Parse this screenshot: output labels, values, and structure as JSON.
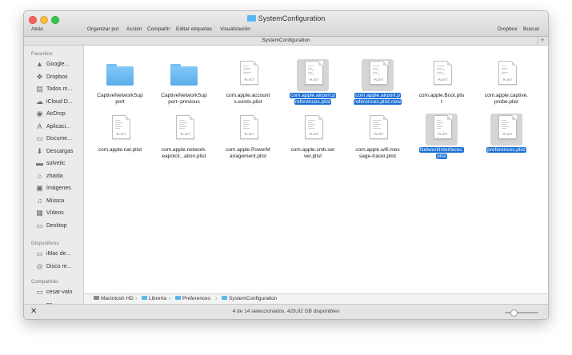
{
  "window": {
    "title": "SystemConfiguration"
  },
  "toolbar": {
    "back": "Atrás",
    "organize": "Organizar por",
    "action": "Acción",
    "share": "Compartir",
    "tags": "Editar etiquetas",
    "view": "Visualización",
    "dropbox": "Dropbox",
    "search": "Buscar"
  },
  "tabbar": {
    "title": "SystemConfiguration"
  },
  "sidebar": {
    "favorites_header": "Favoritos",
    "favorites": [
      {
        "label": "Google...",
        "icon": "google-drive-icon"
      },
      {
        "label": "Dropbox",
        "icon": "dropbox-icon"
      },
      {
        "label": "Todos m...",
        "icon": "all-files-icon"
      },
      {
        "label": "iCloud D...",
        "icon": "icloud-icon"
      },
      {
        "label": "AirDrop",
        "icon": "airdrop-icon"
      },
      {
        "label": "Aplicaci...",
        "icon": "applications-icon"
      },
      {
        "label": "Docume...",
        "icon": "documents-icon"
      },
      {
        "label": "Descargas",
        "icon": "downloads-icon"
      },
      {
        "label": "solvetic",
        "icon": "folder-icon"
      },
      {
        "label": "zhaida",
        "icon": "home-icon"
      },
      {
        "label": "Imágenes",
        "icon": "pictures-icon"
      },
      {
        "label": "Música",
        "icon": "music-icon"
      },
      {
        "label": "Vídeos",
        "icon": "movies-icon"
      },
      {
        "label": "Desktop",
        "icon": "desktop-icon"
      }
    ],
    "devices_header": "Dispositivos",
    "devices": [
      {
        "label": "iMac de...",
        "icon": "imac-icon"
      },
      {
        "label": "Disco re...",
        "icon": "disk-icon"
      }
    ],
    "shared_header": "Compartido",
    "shared": [
      {
        "label": "cesar-vaio",
        "icon": "network-computer-icon"
      },
      {
        "label": "pc...",
        "icon": "network-computer-icon"
      }
    ]
  },
  "files": [
    {
      "name": "CaptiveNetworkSupport",
      "line1": "CaptiveNetworkSup",
      "line2": "port",
      "kind": "folder",
      "selected": false
    },
    {
      "name": "CaptiveNetworkSupport~previous",
      "line1": "CaptiveNetworkSup",
      "line2": "port~previous",
      "kind": "folder",
      "selected": false
    },
    {
      "name": "com.apple.accounts.exists.plist",
      "line1": "com.apple.account",
      "line2": "s.exists.plist",
      "kind": "plist",
      "selected": false
    },
    {
      "name": "com.apple.airport.preferences.plist",
      "line1": "com.apple.airport.p",
      "line2": "references.plist",
      "kind": "plist",
      "selected": true
    },
    {
      "name": "com.apple.airport.preferences.plist-new",
      "line1": "com.apple.airport.p",
      "line2": "references.plist-new",
      "kind": "plist",
      "selected": true
    },
    {
      "name": "com.apple.Boot.plist",
      "line1": "com.apple.Boot.plis",
      "line2": "t",
      "kind": "plist",
      "selected": false
    },
    {
      "name": "com.apple.captive.probe.plist",
      "line1": "com.apple.captive.",
      "line2": "probe.plist",
      "kind": "plist",
      "selected": false
    },
    {
      "name": "com.apple.nat.plist",
      "line1": "com.apple.nat.plist",
      "line2": "",
      "kind": "plist",
      "selected": false
    },
    {
      "name": "com.apple.network.eapolclient.configuration.plist",
      "line1": "com.apple.network.",
      "line2": "eapolcli...ation.plist",
      "kind": "plist",
      "selected": false
    },
    {
      "name": "com.apple.PowerManagement.plist",
      "line1": "com.apple.PowerM",
      "line2": "anagement.plist",
      "kind": "plist",
      "selected": false
    },
    {
      "name": "com.apple.smb.server.plist",
      "line1": "com.apple.smb.ser",
      "line2": "ver.plist",
      "kind": "plist",
      "selected": false
    },
    {
      "name": "com.apple.wifi.message-tracer.plist",
      "line1": "com.apple.wifi.mes",
      "line2": "sage-tracer.plist",
      "kind": "plist",
      "selected": false
    },
    {
      "name": "NetworkInterfaces.plist",
      "line1": "NetworkInterfaces.",
      "line2": "plist",
      "kind": "plist",
      "selected": true
    },
    {
      "name": "preferences.plist",
      "line1": "preferences.plist",
      "line2": "",
      "kind": "plist",
      "selected": true
    }
  ],
  "plist_badge": "PLIST",
  "path": [
    "Macintosh HD",
    "Librería",
    "Preferences",
    "SystemConfiguration"
  ],
  "status": {
    "text": "4 de 14 seleccionados, 429,82 GB disponibles",
    "icon_zoom": 0.2
  },
  "colors": {
    "selection": "#1a6fd6",
    "folder": "#5ab6ef",
    "close": "#fc605c",
    "minimize": "#fdbc40",
    "zoom": "#34c749"
  }
}
